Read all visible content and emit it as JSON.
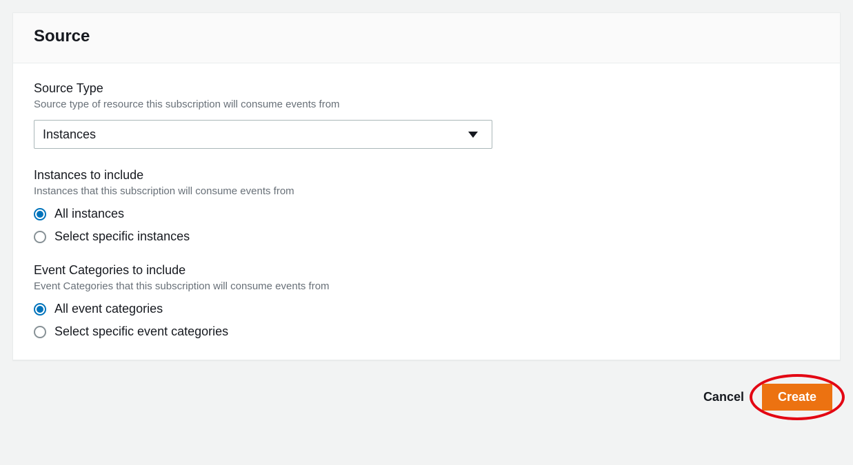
{
  "panel": {
    "title": "Source"
  },
  "sourceType": {
    "label": "Source Type",
    "desc": "Source type of resource this subscription will consume events from",
    "selected": "Instances"
  },
  "instancesInclude": {
    "label": "Instances to include",
    "desc": "Instances that this subscription will consume events from",
    "options": [
      {
        "label": "All instances",
        "checked": true
      },
      {
        "label": "Select specific instances",
        "checked": false
      }
    ]
  },
  "eventCats": {
    "label": "Event Categories to include",
    "desc": "Event Categories that this subscription will consume events from",
    "options": [
      {
        "label": "All event categories",
        "checked": true
      },
      {
        "label": "Select specific event categories",
        "checked": false
      }
    ]
  },
  "footer": {
    "cancel": "Cancel",
    "create": "Create"
  }
}
